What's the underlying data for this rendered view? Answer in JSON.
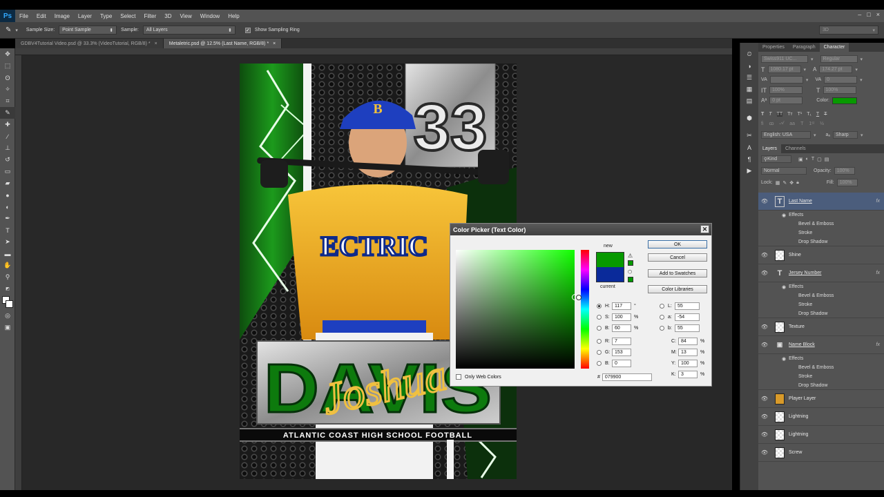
{
  "app": {
    "logo": "Ps"
  },
  "menu": [
    "File",
    "Edit",
    "Image",
    "Layer",
    "Type",
    "Select",
    "Filter",
    "3D",
    "View",
    "Window",
    "Help"
  ],
  "window_controls": [
    "–",
    "□",
    "×"
  ],
  "options": {
    "sample_size_label": "Sample Size:",
    "sample_size_value": "Point Sample",
    "sample_label": "Sample:",
    "sample_value": "All Layers",
    "show_ring_label": "Show Sampling Ring",
    "workspace": "3D"
  },
  "tabs": [
    {
      "label": "GDBV4Tutorial Video.psd @ 33.3% (VideoTutorial, RGB/8) *"
    },
    {
      "label": "Metaletric.psd @ 12.5% (Last Name, RGB/8) *"
    }
  ],
  "artwork": {
    "number": "33",
    "cap_letter": "B",
    "jersey_text": "ECTRIC",
    "last_name": "DAVIS",
    "first_name": "Joshua",
    "banner": "ATLANTIC COAST HIGH SCHOOL FOOTBALL"
  },
  "character_panel": {
    "tabs": [
      "Properties",
      "Paragraph",
      "Character"
    ],
    "font_family": "Swiss911 UC...",
    "font_style": "Regular",
    "size": "1080.17 pt",
    "leading": "174.27 pt",
    "kerning": "",
    "tracking": "0",
    "vscale": "100%",
    "hscale": "100%",
    "baseline": "0 pt",
    "color_label": "Color:",
    "color": "#079900",
    "style_buttons": [
      "T",
      "T",
      "TT",
      "Tт",
      "T¹",
      "T₁",
      "T",
      "T"
    ],
    "language": "English: USA",
    "aa_label": "aₐ",
    "antialias": "Sharp"
  },
  "layers_panel": {
    "tabs": [
      "Layers",
      "Channels"
    ],
    "kind": "Kind",
    "blend": "Normal",
    "opacity_label": "Opacity:",
    "opacity": "100%",
    "lock_label": "Lock:",
    "fill_label": "Fill:",
    "fill": "100%",
    "effects_label": "Effects",
    "layers": [
      {
        "name": "Last Name",
        "type": "text",
        "fx": true,
        "selected": true,
        "effects": [
          "Bevel & Emboss",
          "Stroke",
          "Drop Shadow"
        ]
      },
      {
        "name": "Shine",
        "type": "pixel",
        "fx": false,
        "effects": []
      },
      {
        "name": "Jersey Number",
        "type": "text",
        "fx": true,
        "effects": [
          "Bevel & Emboss",
          "Stroke",
          "Drop Shadow"
        ]
      },
      {
        "name": "Texture",
        "type": "pixel",
        "fx": false,
        "effects": []
      },
      {
        "name": "Name Block",
        "type": "shape",
        "fx": true,
        "effects": [
          "Bevel & Emboss",
          "Stroke",
          "Drop Shadow"
        ]
      },
      {
        "name": "Player Layer",
        "type": "pixel",
        "fx": false,
        "effects": []
      },
      {
        "name": "Lightning",
        "type": "pixel",
        "fx": false,
        "effects": []
      },
      {
        "name": "Lightning",
        "type": "pixel",
        "fx": false,
        "effects": []
      },
      {
        "name": "Screw",
        "type": "pixel",
        "fx": false,
        "effects": []
      }
    ]
  },
  "color_picker": {
    "title": "Color Picker (Text Color)",
    "new_label": "new",
    "current_label": "current",
    "new_color": "#079900",
    "current_color": "#0a2a9a",
    "buttons": {
      "ok": "OK",
      "cancel": "Cancel",
      "add_swatches": "Add to Swatches",
      "libraries": "Color Libraries"
    },
    "hsb": {
      "H": "117",
      "S": "100",
      "B": "60",
      "h_unit": "°",
      "s_unit": "%",
      "b_unit": "%"
    },
    "rgb": {
      "R": "7",
      "G": "153",
      "B": "0"
    },
    "lab": {
      "L": "55",
      "a": "-54",
      "b": "55"
    },
    "cmyk": {
      "C": "84",
      "M": "13",
      "Y": "100",
      "K": "3",
      "unit": "%"
    },
    "hex_label": "#",
    "hex": "079900",
    "only_web_label": "Only Web Colors"
  }
}
